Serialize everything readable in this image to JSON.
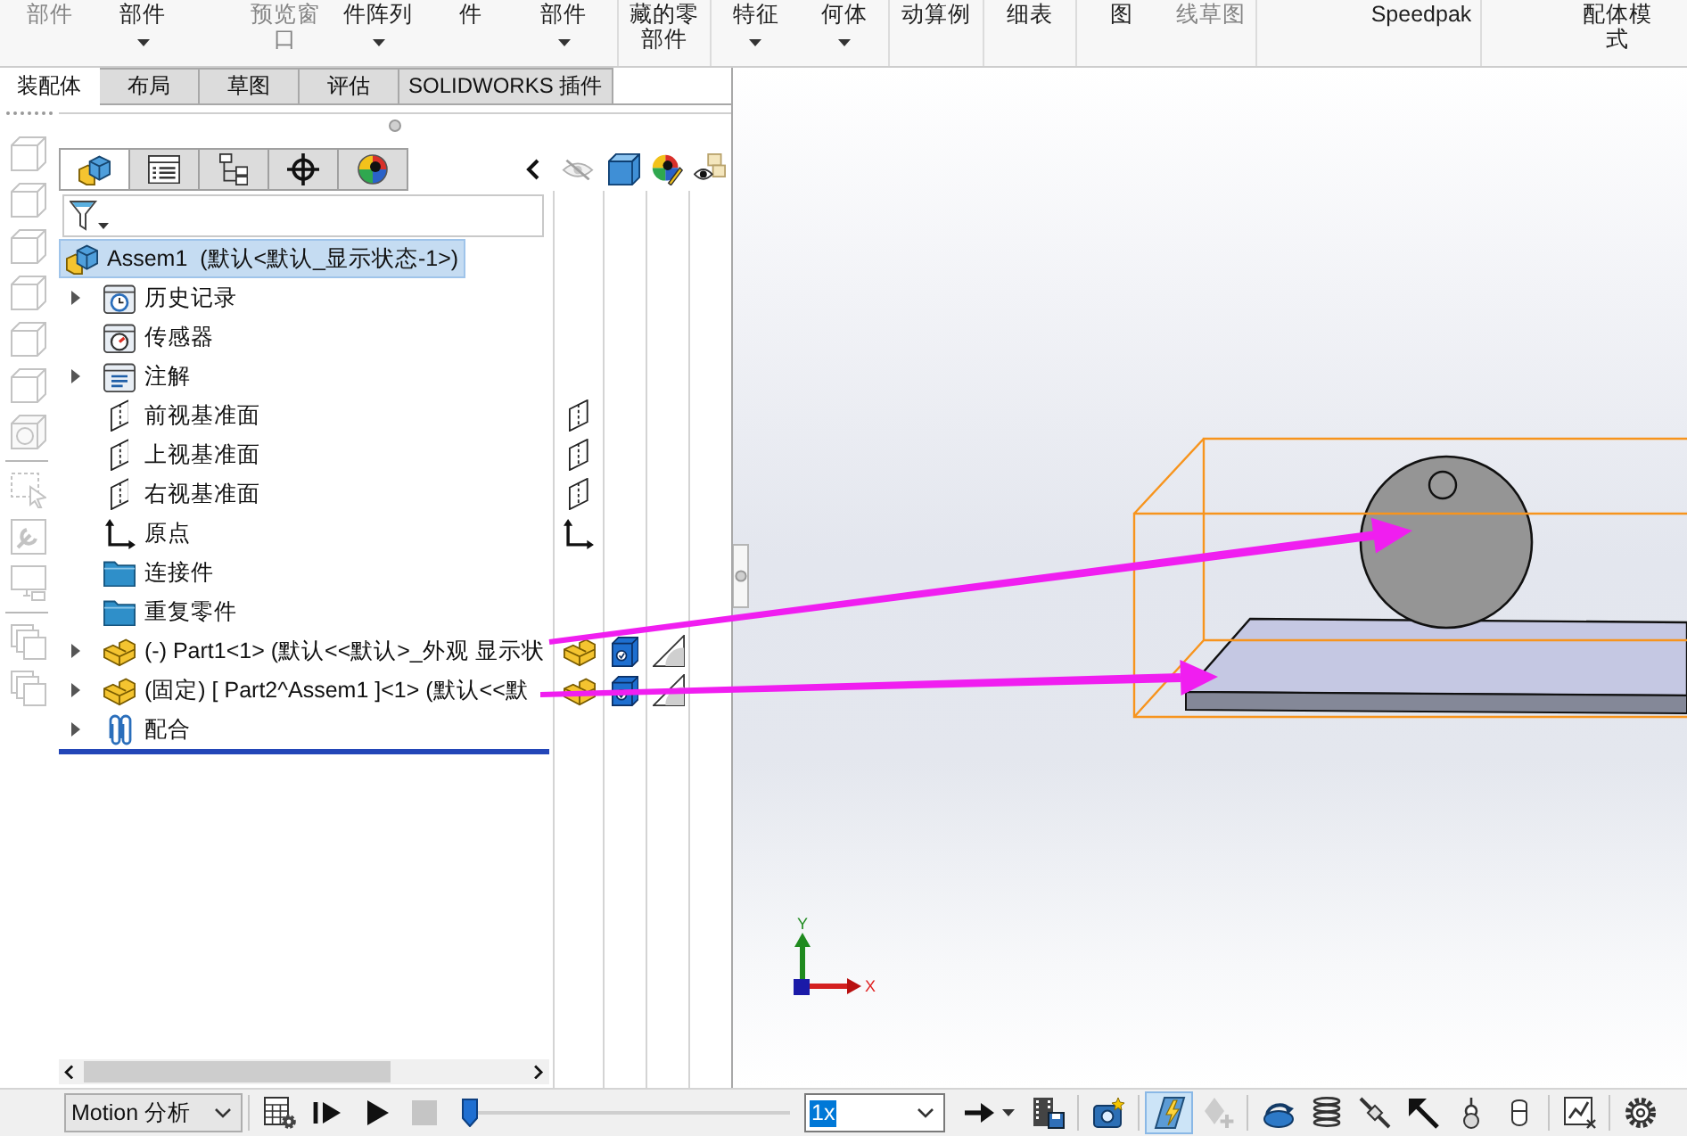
{
  "ribbon": {
    "groups": [
      [
        {
          "label": "部件",
          "disabled": true,
          "dropdown": false
        },
        {
          "label": "部件",
          "disabled": false,
          "dropdown": true
        },
        {
          "label": "预览窗口",
          "disabled": true,
          "dropdown": false
        },
        {
          "label": "件阵列",
          "disabled": false,
          "dropdown": true
        },
        {
          "label": "件",
          "disabled": false,
          "dropdown": false
        },
        {
          "label": "部件",
          "disabled": false,
          "dropdown": true
        }
      ],
      [
        {
          "label": "藏的零部件",
          "disabled": false,
          "dropdown": false
        }
      ],
      [
        {
          "label": "特征",
          "disabled": false,
          "dropdown": true
        },
        {
          "label": "何体",
          "disabled": false,
          "dropdown": true
        }
      ],
      [
        {
          "label": "动算例",
          "disabled": false,
          "dropdown": false
        }
      ],
      [
        {
          "label": "细表",
          "disabled": false,
          "dropdown": false
        }
      ],
      [
        {
          "label": "图",
          "disabled": false,
          "dropdown": false
        },
        {
          "label": "线草图",
          "disabled": true,
          "dropdown": false
        }
      ],
      [
        {
          "label": "Speedpak",
          "disabled": false,
          "dropdown": false
        }
      ],
      [
        {
          "label": "配体模式",
          "disabled": false,
          "dropdown": false
        }
      ]
    ]
  },
  "tabs": [
    {
      "label": "装配体",
      "selected": true
    },
    {
      "label": "布局",
      "selected": false
    },
    {
      "label": "草图",
      "selected": false
    },
    {
      "label": "评估",
      "selected": false
    },
    {
      "label": "SOLIDWORKS 插件",
      "selected": false
    }
  ],
  "side_toolbar": [
    [
      {
        "kind": "cube",
        "disabled": true
      },
      {
        "kind": "cube",
        "disabled": true
      },
      {
        "kind": "cube",
        "disabled": true
      },
      {
        "kind": "cube",
        "disabled": true
      },
      {
        "kind": "cube",
        "disabled": true
      },
      {
        "kind": "cube",
        "disabled": true
      },
      {
        "kind": "shaded-cube",
        "disabled": true
      }
    ],
    [
      {
        "kind": "selection",
        "disabled": true
      },
      {
        "kind": "wrench",
        "disabled": true
      },
      {
        "kind": "monitor",
        "disabled": true
      }
    ],
    [
      {
        "kind": "stack",
        "disabled": true
      },
      {
        "kind": "stack",
        "disabled": true
      }
    ]
  ],
  "feature_manager": {
    "tabs": [
      {
        "kind": "tree",
        "selected": true
      },
      {
        "kind": "properties",
        "selected": false
      },
      {
        "kind": "configurations",
        "selected": false
      },
      {
        "kind": "dimxpert",
        "selected": false
      },
      {
        "kind": "display",
        "selected": false
      }
    ],
    "tree": {
      "label": "Assem1  (默认<默认_显示状态-1>)",
      "kind": "assembly",
      "selected": true,
      "children": [
        {
          "label": "历史记录",
          "kind": "history",
          "expandable": true,
          "selected": false
        },
        {
          "label": "传感器",
          "kind": "sensor",
          "expandable": false,
          "selected": false
        },
        {
          "label": "注解",
          "kind": "annotation",
          "expandable": true,
          "selected": false
        },
        {
          "label": "前视基准面",
          "kind": "plane",
          "expandable": false,
          "selected": false
        },
        {
          "label": "上视基准面",
          "kind": "plane",
          "expandable": false,
          "selected": false
        },
        {
          "label": "右视基准面",
          "kind": "plane",
          "expandable": false,
          "selected": false
        },
        {
          "label": "原点",
          "kind": "origin",
          "expandable": false,
          "selected": false
        },
        {
          "label": "连接件",
          "kind": "folder",
          "expandable": false,
          "selected": false
        },
        {
          "label": "重复零件",
          "kind": "folder",
          "expandable": false,
          "selected": false
        },
        {
          "label": "(-) Part1<1> (默认<<默认>_外观 显示状",
          "kind": "part",
          "expandable": true,
          "selected": false
        },
        {
          "label": "(固定) [ Part2^Assem1 ]<1> (默认<<默",
          "kind": "part",
          "expandable": true,
          "selected": false
        },
        {
          "label": "配合",
          "kind": "mates",
          "expandable": true,
          "selected": false
        }
      ]
    }
  },
  "graphics": {
    "triad": {
      "x_label": "X",
      "y_label": "Y"
    }
  },
  "motion": {
    "study_type": "Motion 分析",
    "playback": [
      {
        "kind": "calculate",
        "disabled": false
      },
      {
        "kind": "play-from-start",
        "disabled": false
      },
      {
        "kind": "play",
        "disabled": false
      },
      {
        "kind": "stop",
        "disabled": true
      }
    ],
    "timeline": {
      "level": 0
    },
    "speed": {
      "value": "1x",
      "highlighted": true
    },
    "tool_groups": [
      [
        {
          "kind": "playback-mode",
          "on": false,
          "disabled": false
        },
        {
          "kind": "save-animation",
          "on": false,
          "disabled": false
        }
      ],
      [
        {
          "kind": "animation-wizard",
          "on": false,
          "disabled": false
        }
      ],
      [
        {
          "kind": "autokey",
          "on": true,
          "disabled": false
        },
        {
          "kind": "add-key",
          "on": false,
          "disabled": true
        }
      ],
      [
        {
          "kind": "motor",
          "on": false,
          "disabled": false
        },
        {
          "kind": "spring",
          "on": false,
          "disabled": false
        },
        {
          "kind": "damper",
          "on": false,
          "disabled": false
        },
        {
          "kind": "force",
          "on": false,
          "disabled": false
        },
        {
          "kind": "contact",
          "on": false,
          "disabled": false
        },
        {
          "kind": "gravity",
          "on": false,
          "disabled": false
        }
      ],
      [
        {
          "kind": "results-plot",
          "on": false,
          "disabled": false
        }
      ],
      [
        {
          "kind": "properties",
          "on": false,
          "disabled": false
        }
      ]
    ]
  }
}
